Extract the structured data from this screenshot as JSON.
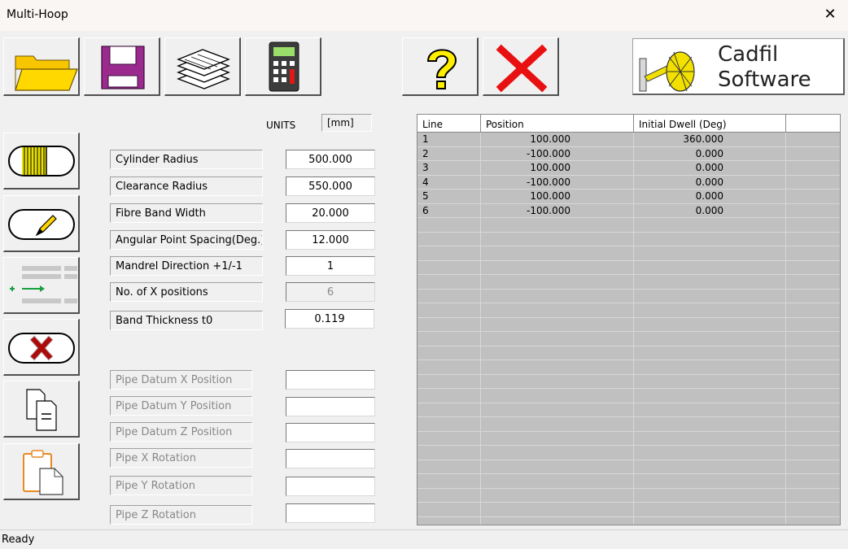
{
  "window": {
    "title": "Multi-Hoop",
    "close_glyph": "✕"
  },
  "toolbar": {
    "open": {
      "icon": "folder-open-icon"
    },
    "save": {
      "icon": "floppy-disk-icon"
    },
    "layers": {
      "icon": "layers-icon"
    },
    "calculator": {
      "icon": "calculator-icon"
    },
    "help": {
      "icon": "question-mark-icon"
    },
    "cancel": {
      "icon": "red-x-icon"
    },
    "logo": {
      "line1": "Cadfil",
      "line2": "Software"
    }
  },
  "units": {
    "label": "UNITS",
    "value": "[mm]"
  },
  "params": [
    {
      "label": "Cylinder Radius",
      "value": "500.000",
      "enabled": true
    },
    {
      "label": "Clearance Radius",
      "value": "550.000",
      "enabled": true
    },
    {
      "label": "Fibre Band Width",
      "value": "20.000",
      "enabled": true
    },
    {
      "label": "Angular Point Spacing(Deg.)",
      "value": "12.000",
      "enabled": true
    },
    {
      "label": "Mandrel Direction +1/-1",
      "value": "1",
      "enabled": true
    },
    {
      "label": "No. of X positions",
      "value": "6",
      "enabled": false
    },
    {
      "label": "Band Thickness t0",
      "value": "0.119",
      "enabled": true
    }
  ],
  "pipe": [
    {
      "label": "Pipe Datum X Position",
      "value": ""
    },
    {
      "label": "Pipe Datum Y Position",
      "value": ""
    },
    {
      "label": "Pipe Datum Z Position",
      "value": ""
    },
    {
      "label": "Pipe X Rotation",
      "value": ""
    },
    {
      "label": "Pipe Y Rotation",
      "value": ""
    },
    {
      "label": "Pipe Z Rotation",
      "value": ""
    }
  ],
  "table": {
    "headers": [
      "Line",
      "Position",
      "Initial Dwell (Deg)",
      ""
    ],
    "rows": [
      [
        "1",
        "100.000",
        "360.000"
      ],
      [
        "2",
        "-100.000",
        "0.000"
      ],
      [
        "3",
        "100.000",
        "0.000"
      ],
      [
        "4",
        "-100.000",
        "0.000"
      ],
      [
        "5",
        "100.000",
        "0.000"
      ],
      [
        "6",
        "-100.000",
        "0.000"
      ]
    ]
  },
  "status": {
    "text": "Ready"
  }
}
